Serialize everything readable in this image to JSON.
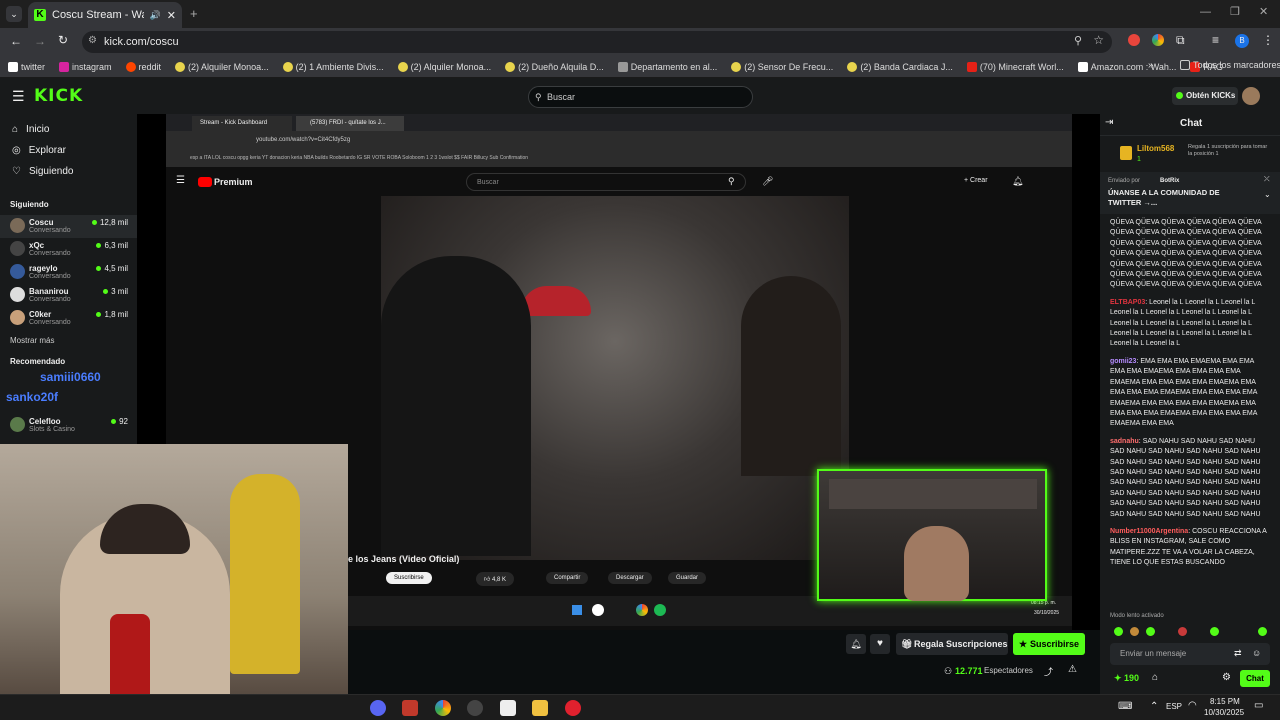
{
  "browser": {
    "tab_title": "Coscu Stream - Watch Live",
    "url": "kick.com/coscu",
    "bookmarks": [
      "twitter",
      "instagram",
      "reddit",
      "(2) Alquiler Monoa...",
      "(2) 1 Ambiente Divis...",
      "(2) Alquiler Monoa...",
      "(2) Dueño Alquila D...",
      "Departamento en al...",
      "(2) Sensor De Frecu...",
      "(2) Banda Cardiaca J...",
      "(70) Minecraft Worl...",
      "Amazon.com : Wah...",
      "RAG"
    ],
    "all_bookmarks": "Todos los marcadores",
    "profile_initial": "B"
  },
  "kick": {
    "logo": "KICK",
    "search_placeholder": "Buscar",
    "get_kicks": "Obtén KICKs"
  },
  "sidebar": {
    "nav": [
      "Inicio",
      "Explorar",
      "Siguiendo"
    ],
    "following_header": "Siguiendo",
    "following": [
      {
        "name": "Coscu",
        "status": "Conversando",
        "viewers": "12,8 mil"
      },
      {
        "name": "xQc",
        "status": "Conversando",
        "viewers": "6,3 mil"
      },
      {
        "name": "rageylo",
        "status": "Conversando",
        "viewers": "4,5 mil"
      },
      {
        "name": "Bananirou",
        "status": "Conversando",
        "viewers": "3 mil"
      },
      {
        "name": "C0ker",
        "status": "Conversando",
        "viewers": "1,8 mil"
      }
    ],
    "show_more": "Mostrar más",
    "recommended_header": "Recomendado",
    "recommended": [
      {
        "name": "Celefloo",
        "status": "Slots & Casino",
        "viewers": "92"
      }
    ],
    "overlay_names": [
      "samiii0660",
      "sanko20f"
    ]
  },
  "inner": {
    "tabs": [
      "Stream - Kick Dashboard",
      "(5783) FRDI - quítate los J..."
    ],
    "url": "youtube.com/watch?v=Cit4Cfdy5zg",
    "bookmarks": "esp a ITA  LOL  coscu  opgg keria  YT  donacion  keria  NBA  builds  Roobetardo  IG  SR  VOTE  ROBA  Soloboom  1  2  3  1wslot  $$  FAIR  Billucy  Sub Confirmation",
    "yt_logo": "Premium",
    "yt_search": "Buscar",
    "create": "+ Crear",
    "video_title": "e los Jeans (Video Oficial)",
    "subscribe": "Suscribirse",
    "likes": "4,8 K",
    "share": "Compartir",
    "download": "Descargar",
    "save": "Guardar",
    "clock": "08:15 p. m.",
    "date": "30/10/2025"
  },
  "player": {
    "gift_subs": "Regala Suscripciones",
    "subscribe": "Suscribirse",
    "viewers": "12.771",
    "viewers_label": "Espectadores"
  },
  "chat": {
    "title": "Chat",
    "top_gifter": {
      "name": "Liltom568",
      "count": "1",
      "note": "Regala 1 suscripción para tomar la posición 1"
    },
    "pinned_by": "Enviado por",
    "pinned_user": "BotRix",
    "pinned_text": "ÚNANSE A LA COMUNIDAD DE TWITTER →...",
    "messages": [
      {
        "user": "",
        "color": "#ffffff",
        "text": "QÜEVA QÜEVA QÜEVA QÜEVA QÜEVA QÜEVA QÜEVA QÜEVA QÜEVA QÜEVA QÜEVA QÜEVA QÜEVA QÜEVA QÜEVA QÜEVA QÜEVA QÜEVA QÜEVA QÜEVA QÜEVA QÜEVA QÜEVA QÜEVA QÜEVA QÜEVA QÜEVA QÜEVA QÜEVA QÜEVA QÜEVA QÜEVA QÜEVA QÜEVA QÜEVA QÜEVA QÜEVA QÜEVA QÜEVA QÜEVA QÜEVA QÜEVA"
      },
      {
        "user": "ELTBAP03",
        "color": "#e0343f",
        "text": "Leonel la L Leonel la L Leonel la L Leonel la L Leonel la L Leonel la L Leonel la L Leonel la L Leonel la L Leonel la L Leonel la L Leonel la L Leonel la L Leonel la L Leonel la L Leonel la L Leonel la L"
      },
      {
        "user": "gomii23",
        "color": "#b58cff",
        "text": "EMA EMA EMA EMAEMA EMA EMA EMA EMA EMAEMA EMA EMA EMA EMA EMAEMA EMA EMA EMA EMA EMAEMA EMA EMA EMA EMA EMAEMA EMA EMA EMA EMA EMAEMA EMA EMA EMA EMA EMAEMA EMA EMA EMA EMA EMAEMA EMA EMA EMA EMA EMAEMA EMA EMA"
      },
      {
        "user": "sadnahu",
        "color": "#ff6d6d",
        "text": "SAD NAHU SAD NAHU SAD NAHU SAD NAHU SAD NAHU SAD NAHU SAD NAHU SAD NAHU SAD NAHU SAD NAHU SAD NAHU SAD NAHU SAD NAHU SAD NAHU SAD NAHU SAD NAHU SAD NAHU SAD NAHU SAD NAHU SAD NAHU SAD NAHU SAD NAHU SAD NAHU SAD NAHU SAD NAHU SAD NAHU SAD NAHU SAD NAHU SAD NAHU SAD NAHU SAD NAHU"
      },
      {
        "user": "Number11000Argentina",
        "color": "#ff5c5c",
        "text": "COSCU REACCIONA A BLISS EN INSTAGRAM, SALE COMO MATIPERE.ZZZ TE VA A VOLAR LA CABEZA, TIENE LO QUE ESTAS BUSCANDO"
      }
    ],
    "slow_mode": "Modo lento activado",
    "input_placeholder": "Enviar un mensaje",
    "points": "190",
    "send": "Chat"
  },
  "taskbar": {
    "lang": "ESP",
    "time": "8:15 PM",
    "date": "10/30/2025"
  },
  "colors": {
    "accent": "#53fc18",
    "bg": "#0b0e0f",
    "panel": "#181a1b"
  }
}
